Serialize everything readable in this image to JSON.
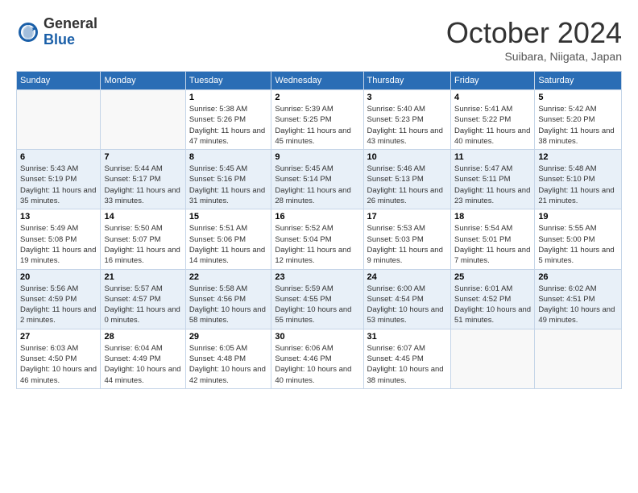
{
  "header": {
    "logo": {
      "general": "General",
      "blue": "Blue"
    },
    "title": "October 2024",
    "location": "Suibara, Niigata, Japan"
  },
  "weekdays": [
    "Sunday",
    "Monday",
    "Tuesday",
    "Wednesday",
    "Thursday",
    "Friday",
    "Saturday"
  ],
  "weeks": [
    [
      null,
      null,
      {
        "day": 1,
        "sunrise": "Sunrise: 5:38 AM",
        "sunset": "Sunset: 5:26 PM",
        "daylight": "Daylight: 11 hours and 47 minutes."
      },
      {
        "day": 2,
        "sunrise": "Sunrise: 5:39 AM",
        "sunset": "Sunset: 5:25 PM",
        "daylight": "Daylight: 11 hours and 45 minutes."
      },
      {
        "day": 3,
        "sunrise": "Sunrise: 5:40 AM",
        "sunset": "Sunset: 5:23 PM",
        "daylight": "Daylight: 11 hours and 43 minutes."
      },
      {
        "day": 4,
        "sunrise": "Sunrise: 5:41 AM",
        "sunset": "Sunset: 5:22 PM",
        "daylight": "Daylight: 11 hours and 40 minutes."
      },
      {
        "day": 5,
        "sunrise": "Sunrise: 5:42 AM",
        "sunset": "Sunset: 5:20 PM",
        "daylight": "Daylight: 11 hours and 38 minutes."
      }
    ],
    [
      {
        "day": 6,
        "sunrise": "Sunrise: 5:43 AM",
        "sunset": "Sunset: 5:19 PM",
        "daylight": "Daylight: 11 hours and 35 minutes."
      },
      {
        "day": 7,
        "sunrise": "Sunrise: 5:44 AM",
        "sunset": "Sunset: 5:17 PM",
        "daylight": "Daylight: 11 hours and 33 minutes."
      },
      {
        "day": 8,
        "sunrise": "Sunrise: 5:45 AM",
        "sunset": "Sunset: 5:16 PM",
        "daylight": "Daylight: 11 hours and 31 minutes."
      },
      {
        "day": 9,
        "sunrise": "Sunrise: 5:45 AM",
        "sunset": "Sunset: 5:14 PM",
        "daylight": "Daylight: 11 hours and 28 minutes."
      },
      {
        "day": 10,
        "sunrise": "Sunrise: 5:46 AM",
        "sunset": "Sunset: 5:13 PM",
        "daylight": "Daylight: 11 hours and 26 minutes."
      },
      {
        "day": 11,
        "sunrise": "Sunrise: 5:47 AM",
        "sunset": "Sunset: 5:11 PM",
        "daylight": "Daylight: 11 hours and 23 minutes."
      },
      {
        "day": 12,
        "sunrise": "Sunrise: 5:48 AM",
        "sunset": "Sunset: 5:10 PM",
        "daylight": "Daylight: 11 hours and 21 minutes."
      }
    ],
    [
      {
        "day": 13,
        "sunrise": "Sunrise: 5:49 AM",
        "sunset": "Sunset: 5:08 PM",
        "daylight": "Daylight: 11 hours and 19 minutes."
      },
      {
        "day": 14,
        "sunrise": "Sunrise: 5:50 AM",
        "sunset": "Sunset: 5:07 PM",
        "daylight": "Daylight: 11 hours and 16 minutes."
      },
      {
        "day": 15,
        "sunrise": "Sunrise: 5:51 AM",
        "sunset": "Sunset: 5:06 PM",
        "daylight": "Daylight: 11 hours and 14 minutes."
      },
      {
        "day": 16,
        "sunrise": "Sunrise: 5:52 AM",
        "sunset": "Sunset: 5:04 PM",
        "daylight": "Daylight: 11 hours and 12 minutes."
      },
      {
        "day": 17,
        "sunrise": "Sunrise: 5:53 AM",
        "sunset": "Sunset: 5:03 PM",
        "daylight": "Daylight: 11 hours and 9 minutes."
      },
      {
        "day": 18,
        "sunrise": "Sunrise: 5:54 AM",
        "sunset": "Sunset: 5:01 PM",
        "daylight": "Daylight: 11 hours and 7 minutes."
      },
      {
        "day": 19,
        "sunrise": "Sunrise: 5:55 AM",
        "sunset": "Sunset: 5:00 PM",
        "daylight": "Daylight: 11 hours and 5 minutes."
      }
    ],
    [
      {
        "day": 20,
        "sunrise": "Sunrise: 5:56 AM",
        "sunset": "Sunset: 4:59 PM",
        "daylight": "Daylight: 11 hours and 2 minutes."
      },
      {
        "day": 21,
        "sunrise": "Sunrise: 5:57 AM",
        "sunset": "Sunset: 4:57 PM",
        "daylight": "Daylight: 11 hours and 0 minutes."
      },
      {
        "day": 22,
        "sunrise": "Sunrise: 5:58 AM",
        "sunset": "Sunset: 4:56 PM",
        "daylight": "Daylight: 10 hours and 58 minutes."
      },
      {
        "day": 23,
        "sunrise": "Sunrise: 5:59 AM",
        "sunset": "Sunset: 4:55 PM",
        "daylight": "Daylight: 10 hours and 55 minutes."
      },
      {
        "day": 24,
        "sunrise": "Sunrise: 6:00 AM",
        "sunset": "Sunset: 4:54 PM",
        "daylight": "Daylight: 10 hours and 53 minutes."
      },
      {
        "day": 25,
        "sunrise": "Sunrise: 6:01 AM",
        "sunset": "Sunset: 4:52 PM",
        "daylight": "Daylight: 10 hours and 51 minutes."
      },
      {
        "day": 26,
        "sunrise": "Sunrise: 6:02 AM",
        "sunset": "Sunset: 4:51 PM",
        "daylight": "Daylight: 10 hours and 49 minutes."
      }
    ],
    [
      {
        "day": 27,
        "sunrise": "Sunrise: 6:03 AM",
        "sunset": "Sunset: 4:50 PM",
        "daylight": "Daylight: 10 hours and 46 minutes."
      },
      {
        "day": 28,
        "sunrise": "Sunrise: 6:04 AM",
        "sunset": "Sunset: 4:49 PM",
        "daylight": "Daylight: 10 hours and 44 minutes."
      },
      {
        "day": 29,
        "sunrise": "Sunrise: 6:05 AM",
        "sunset": "Sunset: 4:48 PM",
        "daylight": "Daylight: 10 hours and 42 minutes."
      },
      {
        "day": 30,
        "sunrise": "Sunrise: 6:06 AM",
        "sunset": "Sunset: 4:46 PM",
        "daylight": "Daylight: 10 hours and 40 minutes."
      },
      {
        "day": 31,
        "sunrise": "Sunrise: 6:07 AM",
        "sunset": "Sunset: 4:45 PM",
        "daylight": "Daylight: 10 hours and 38 minutes."
      },
      null,
      null
    ]
  ]
}
